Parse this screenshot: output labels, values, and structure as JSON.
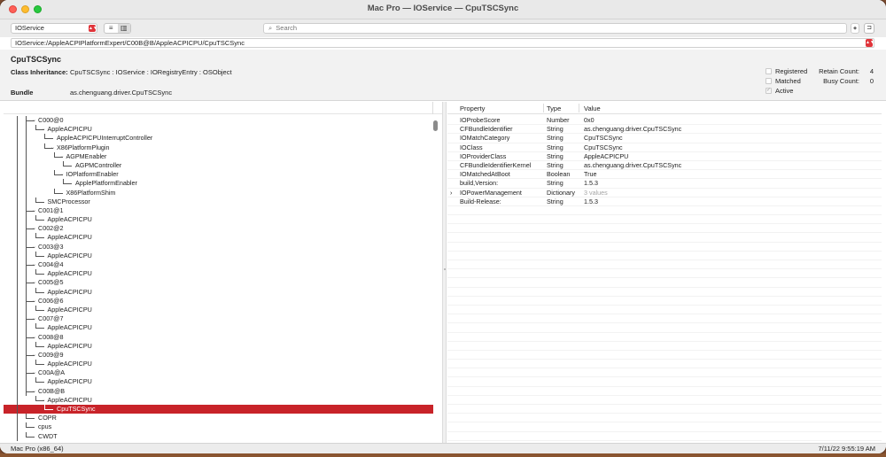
{
  "window": {
    "title": "Mac Pro — IOService — CpuTSCSync"
  },
  "toolbar": {
    "plane": "IOService",
    "search_placeholder": "Search",
    "view_list_icon": "list-view-icon",
    "view_columns_icon": "columns-view-icon"
  },
  "path": "IOService:/AppleACPIPlatformExpert/C00B@B/AppleACPICPU/CpuTSCSync",
  "info": {
    "name": "CpuTSCSync",
    "class_inheritance_label": "Class Inheritance:",
    "class_inheritance": "CpuTSCSync : IOService : IORegistryEntry : OSObject",
    "bundle_label": "Bundle",
    "bundle": "as.chenguang.driver.CpuTSCSync",
    "registered_label": "Registered",
    "registered": false,
    "matched_label": "Matched",
    "matched": false,
    "active_label": "Active",
    "active": true,
    "retain_label": "Retain Count:",
    "retain": "4",
    "busy_label": "Busy Count:",
    "busy": "0"
  },
  "tree": {
    "rows": [
      {
        "label": "C000@0",
        "level": 0,
        "expanded": true
      },
      {
        "label": "AppleACPICPU",
        "level": 1,
        "expanded": true
      },
      {
        "label": "AppleACPICPUInterruptController",
        "level": 2
      },
      {
        "label": "X86PlatformPlugin",
        "level": 2,
        "expanded": true
      },
      {
        "label": "AGPMEnabler",
        "level": 3,
        "expanded": true
      },
      {
        "label": "AGPMController",
        "level": 4
      },
      {
        "label": "IOPlatformEnabler",
        "level": 3,
        "expanded": true
      },
      {
        "label": "ApplePlatformEnabler",
        "level": 4
      },
      {
        "label": "X86PlatformShim",
        "level": 3
      },
      {
        "label": "SMCProcessor",
        "level": 1
      },
      {
        "label": "C001@1",
        "level": 0,
        "expanded": true
      },
      {
        "label": "AppleACPICPU",
        "level": 1
      },
      {
        "label": "C002@2",
        "level": 0,
        "expanded": true
      },
      {
        "label": "AppleACPICPU",
        "level": 1
      },
      {
        "label": "C003@3",
        "level": 0,
        "expanded": true
      },
      {
        "label": "AppleACPICPU",
        "level": 1
      },
      {
        "label": "C004@4",
        "level": 0,
        "expanded": true
      },
      {
        "label": "AppleACPICPU",
        "level": 1
      },
      {
        "label": "C005@5",
        "level": 0,
        "expanded": true
      },
      {
        "label": "AppleACPICPU",
        "level": 1
      },
      {
        "label": "C006@6",
        "level": 0,
        "expanded": true
      },
      {
        "label": "AppleACPICPU",
        "level": 1
      },
      {
        "label": "C007@7",
        "level": 0,
        "expanded": true
      },
      {
        "label": "AppleACPICPU",
        "level": 1
      },
      {
        "label": "C008@8",
        "level": 0,
        "expanded": true
      },
      {
        "label": "AppleACPICPU",
        "level": 1
      },
      {
        "label": "C009@9",
        "level": 0,
        "expanded": true
      },
      {
        "label": "AppleACPICPU",
        "level": 1
      },
      {
        "label": "C00A@A",
        "level": 0,
        "expanded": true
      },
      {
        "label": "AppleACPICPU",
        "level": 1
      },
      {
        "label": "C00B@B",
        "level": 0,
        "expanded": true
      },
      {
        "label": "AppleACPICPU",
        "level": 1,
        "expanded": true
      },
      {
        "label": "CpuTSCSync",
        "level": 2,
        "selected": true
      },
      {
        "label": "COPR",
        "level": 0
      },
      {
        "label": "cpus",
        "level": 0
      },
      {
        "label": "CWDT",
        "level": 0
      }
    ]
  },
  "properties": {
    "headers": {
      "property": "Property",
      "type": "Type",
      "value": "Value"
    },
    "rows": [
      {
        "property": "IOProbeScore",
        "type": "Number",
        "value": "0x0"
      },
      {
        "property": "CFBundleIdentifier",
        "type": "String",
        "value": "as.chenguang.driver.CpuTSCSync"
      },
      {
        "property": "IOMatchCategory",
        "type": "String",
        "value": "CpuTSCSync"
      },
      {
        "property": "IOClass",
        "type": "String",
        "value": "CpuTSCSync"
      },
      {
        "property": "IOProviderClass",
        "type": "String",
        "value": "AppleACPICPU"
      },
      {
        "property": "CFBundleIdentifierKernel",
        "type": "String",
        "value": "as.chenguang.driver.CpuTSCSync"
      },
      {
        "property": "IOMatchedAtBoot",
        "type": "Boolean",
        "value": "True"
      },
      {
        "property": "build,Version:",
        "type": "String",
        "value": "1.5.3"
      },
      {
        "property": "IOPowerManagement",
        "type": "Dictionary",
        "value": "3 values",
        "dim": true,
        "expandable": true
      },
      {
        "property": "Build-Release:",
        "type": "String",
        "value": "1.5.3"
      }
    ]
  },
  "status": {
    "left": "Mac Pro (x86_64)",
    "right": "7/11/22 9:55:19 AM"
  }
}
